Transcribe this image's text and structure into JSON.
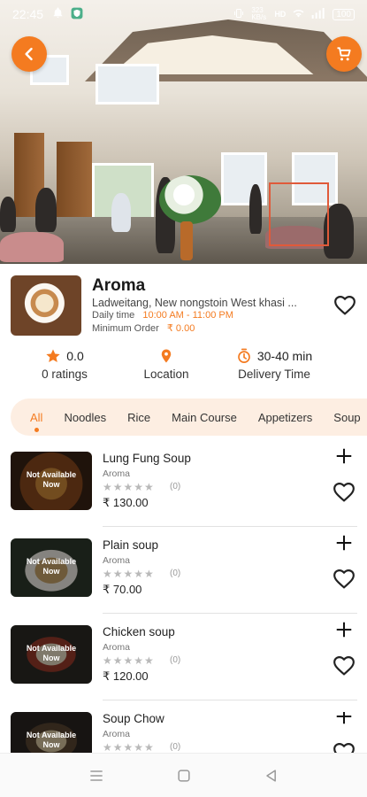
{
  "status_bar": {
    "time": "22:45",
    "right_text": "323 KB/s",
    "battery": "100",
    "icons": [
      "notification-bell-icon",
      "shield-app-icon",
      "vibrate-icon",
      "hd-icon",
      "wifi-icon",
      "signal-icon",
      "battery-icon"
    ]
  },
  "header": {
    "back_icon": "chevron-left-icon",
    "cart_icon": "cart-icon",
    "accent": "#f47b20"
  },
  "restaurant": {
    "name": "Aroma",
    "address": "Ladweitang, New nongstoin West khasi ...",
    "daily_time_label": "Daily time",
    "daily_time_value": "10:00 AM - 11:00 PM",
    "min_order_label": "Minimum Order",
    "min_order_value": "₹ 0.00"
  },
  "stats": {
    "rating_value": "0.0",
    "rating_label": "0 ratings",
    "location_label": "Location",
    "delivery_value": "30-40 min",
    "delivery_label": "Delivery Time"
  },
  "tabs": [
    {
      "label": "All",
      "active": true
    },
    {
      "label": "Noodles",
      "active": false
    },
    {
      "label": "Rice",
      "active": false
    },
    {
      "label": "Main Course",
      "active": false
    },
    {
      "label": "Appetizers",
      "active": false
    },
    {
      "label": "Soup",
      "active": false
    }
  ],
  "menu": {
    "not_available_line1": "Not Available",
    "not_available_line2": "Now",
    "stars": "★★★★★",
    "items": [
      {
        "name": "Lung Fung Soup",
        "restaurant": "Aroma",
        "count": "(0)",
        "price": "₹ 130.00"
      },
      {
        "name": "Plain soup",
        "restaurant": "Aroma",
        "count": "(0)",
        "price": "₹ 70.00"
      },
      {
        "name": "Chicken soup",
        "restaurant": "Aroma",
        "count": "(0)",
        "price": "₹ 120.00"
      },
      {
        "name": "Soup Chow",
        "restaurant": "Aroma",
        "count": "(0)",
        "price": ""
      }
    ]
  },
  "nav": {
    "icons": [
      "menu-icon",
      "home-square-icon",
      "back-triangle-icon"
    ]
  }
}
